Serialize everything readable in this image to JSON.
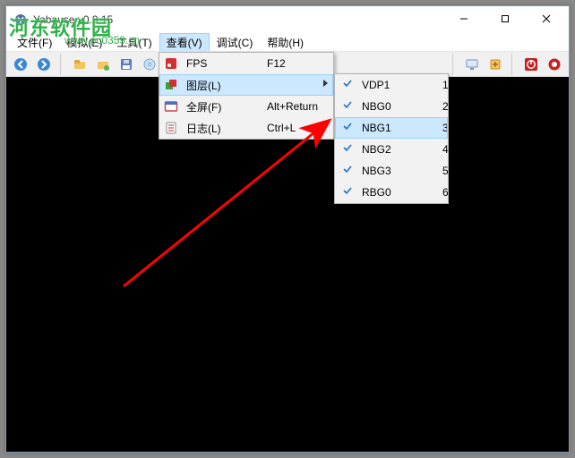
{
  "window": {
    "title": "Yabause v0.9.15"
  },
  "menubar": {
    "items": [
      {
        "label": "文件(F)"
      },
      {
        "label": "模拟(E)"
      },
      {
        "label": "工具(T)"
      },
      {
        "label": "查看(V)",
        "open": true
      },
      {
        "label": "调试(C)"
      },
      {
        "label": "帮助(H)"
      }
    ]
  },
  "toolbar_icons": [
    "back-icon",
    "forward-icon",
    "sep",
    "open-icon",
    "open2-icon",
    "save-icon",
    "disc-icon",
    "sep",
    "gap",
    "sep",
    "monitor-icon",
    "tools-icon",
    "sep",
    "power-icon",
    "record-icon"
  ],
  "view_menu": {
    "items": [
      {
        "icon": "fps-icon",
        "label": "FPS",
        "accel": "F12"
      },
      {
        "icon": "layers-icon",
        "label": "图层(L)",
        "submenu": true,
        "highlight": true
      },
      {
        "icon": "fullscreen-icon",
        "label": "全屏(F)",
        "accel": "Alt+Return"
      },
      {
        "icon": "log-icon",
        "label": "日志(L)",
        "accel": "Ctrl+L"
      }
    ]
  },
  "layers_submenu": {
    "items": [
      {
        "checked": true,
        "label": "VDP1",
        "num": "1"
      },
      {
        "checked": true,
        "label": "NBG0",
        "num": "2"
      },
      {
        "checked": true,
        "label": "NBG1",
        "num": "3",
        "highlight": true
      },
      {
        "checked": true,
        "label": "NBG2",
        "num": "4"
      },
      {
        "checked": true,
        "label": "NBG3",
        "num": "5"
      },
      {
        "checked": true,
        "label": "RBG0",
        "num": "6"
      }
    ]
  },
  "watermark": {
    "main": "河东软件园",
    "sub": "www.pc0359.cn"
  }
}
